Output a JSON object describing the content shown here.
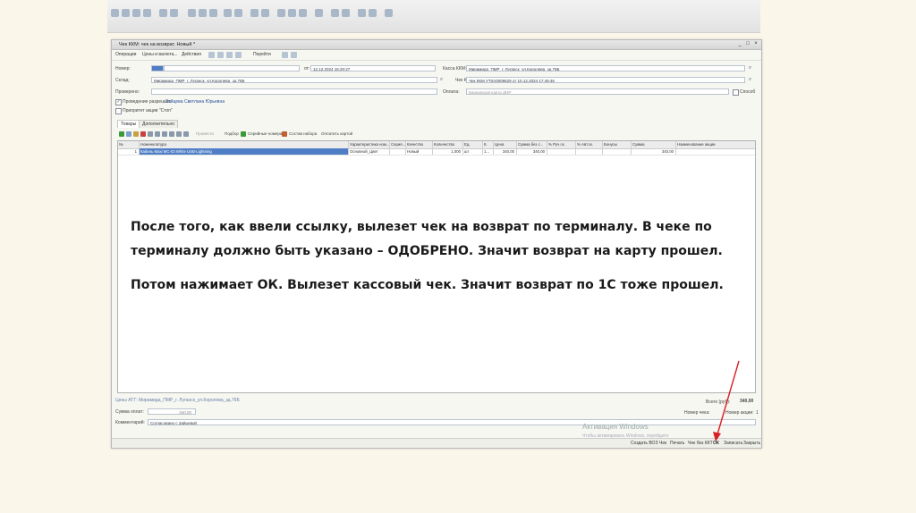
{
  "window": {
    "title": "Чек ККМ: чек на возврат. Новый *",
    "menu": [
      "Операции",
      "Цены и валюта...",
      "Действия",
      "Перейти"
    ]
  },
  "header_fields": {
    "nomer_label": "Номер:",
    "ot_label": "от:",
    "date_value": "12.12.2024 16:20:27",
    "kassa_label": "Касса ККМ:",
    "kassa_value": "Мирамида_ПМР_г. Луганск_ул.Королева_зд.76Б",
    "sklad_label": "Склад:",
    "sklad_value": "Мирамида_ПМР_г. Луганск_ул.Королева_зд.76Б",
    "chek_label": "Чек ККМ:",
    "chek_value": "Чек ККМ УТ0А0009629 от 10.12.2024 17:49:46",
    "prover_label": "Проверено:",
    "oplata_label": "Оплата:",
    "oplata_value": "Банковская карта ДНР",
    "sposob_label": "Способ",
    "razresh_label": "Проведение разрешил:",
    "razresh_value": "Зайцева Светлана Юрьевна",
    "prioritet_label": "Приоритет акции \"Стоп\""
  },
  "tabs": [
    "Товары",
    "Дополнительно"
  ],
  "toolbar": {
    "pick": "Подбор",
    "serial": "Серийные номера",
    "set": "Состав набора",
    "card": "Оплатить картой",
    "provide": "Провести"
  },
  "table": {
    "columns": [
      "№",
      "Номенклатура",
      "Характеристика ном...",
      "Серия...",
      "Качество",
      "Количество",
      "Ед.",
      "К.",
      "Цена",
      "Сумма без с...",
      "% Руч.ск.",
      "% Авт.ск.",
      "Бонусы",
      "Сумма",
      "Наименование акции"
    ],
    "rows": [
      [
        "1",
        "Кабель Maxi MC-03 White USB-Lightning",
        "Основной_Цвет",
        "",
        "Новый",
        "1,000",
        "шт",
        "1...",
        "340,00",
        "340,00",
        "",
        "",
        "",
        "340,00",
        ""
      ]
    ]
  },
  "caption": {
    "line1": "После того, как ввели ссылку, вылезет чек на возврат по терминалу. В чеке по",
    "line2": "терминалу должно быть указано – ОДОБРЕНО. Значит возврат на карту прошел.",
    "line3": "Потом нажимает ОК. Вылезет кассовый чек. Значит возврат по 1С тоже прошел."
  },
  "bottom": {
    "price_type": "Цены АТТ: Мирамида_ПМР_г. Луганск_ул.Королева_зд.76Б",
    "total_label": "Всего (руб):",
    "total_value": "340,00",
    "paid_label": "Сумма оплат:",
    "paid_value": "340,00",
    "cheque_no_label": "Номер чека:",
    "action_no_label": "Номер акции:",
    "action_no_value": "1",
    "comment_label": "Комментарий:",
    "comment_value": "Согласовано с Зайцевой"
  },
  "statusbar": {
    "watermark1": "Активация Windows",
    "watermark2": "Чтобы активировать Windows, перейдите",
    "buttons": [
      "Создать ВОЗ",
      "Чек",
      "Печать",
      "Чек без ККТ",
      "ОК",
      "Записать",
      "Закрыть"
    ]
  },
  "colors": {
    "accent_arrow": "#d81f26",
    "selected_row": "#4f7ec7"
  }
}
